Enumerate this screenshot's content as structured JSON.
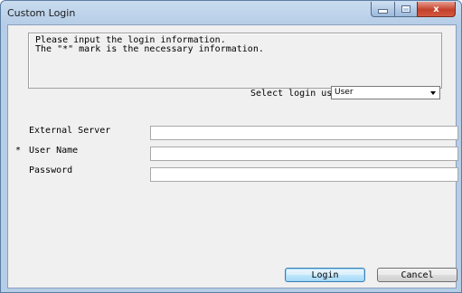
{
  "window": {
    "title": "Custom Login",
    "controls": {
      "minimize": "–",
      "maximize": "",
      "close": "x"
    }
  },
  "info": {
    "line1": "Please input the login information.",
    "line2": "The \"*\" mark is the necessary information."
  },
  "login_user": {
    "label": "Select login user",
    "selected": "User"
  },
  "form": {
    "required_mark": "*",
    "external_server_label": "External Server",
    "external_server_value": "",
    "user_name_label": "User Name",
    "user_name_value": "",
    "password_label": "Password",
    "password_value": ""
  },
  "buttons": {
    "login": "Login",
    "cancel": "Cancel"
  }
}
